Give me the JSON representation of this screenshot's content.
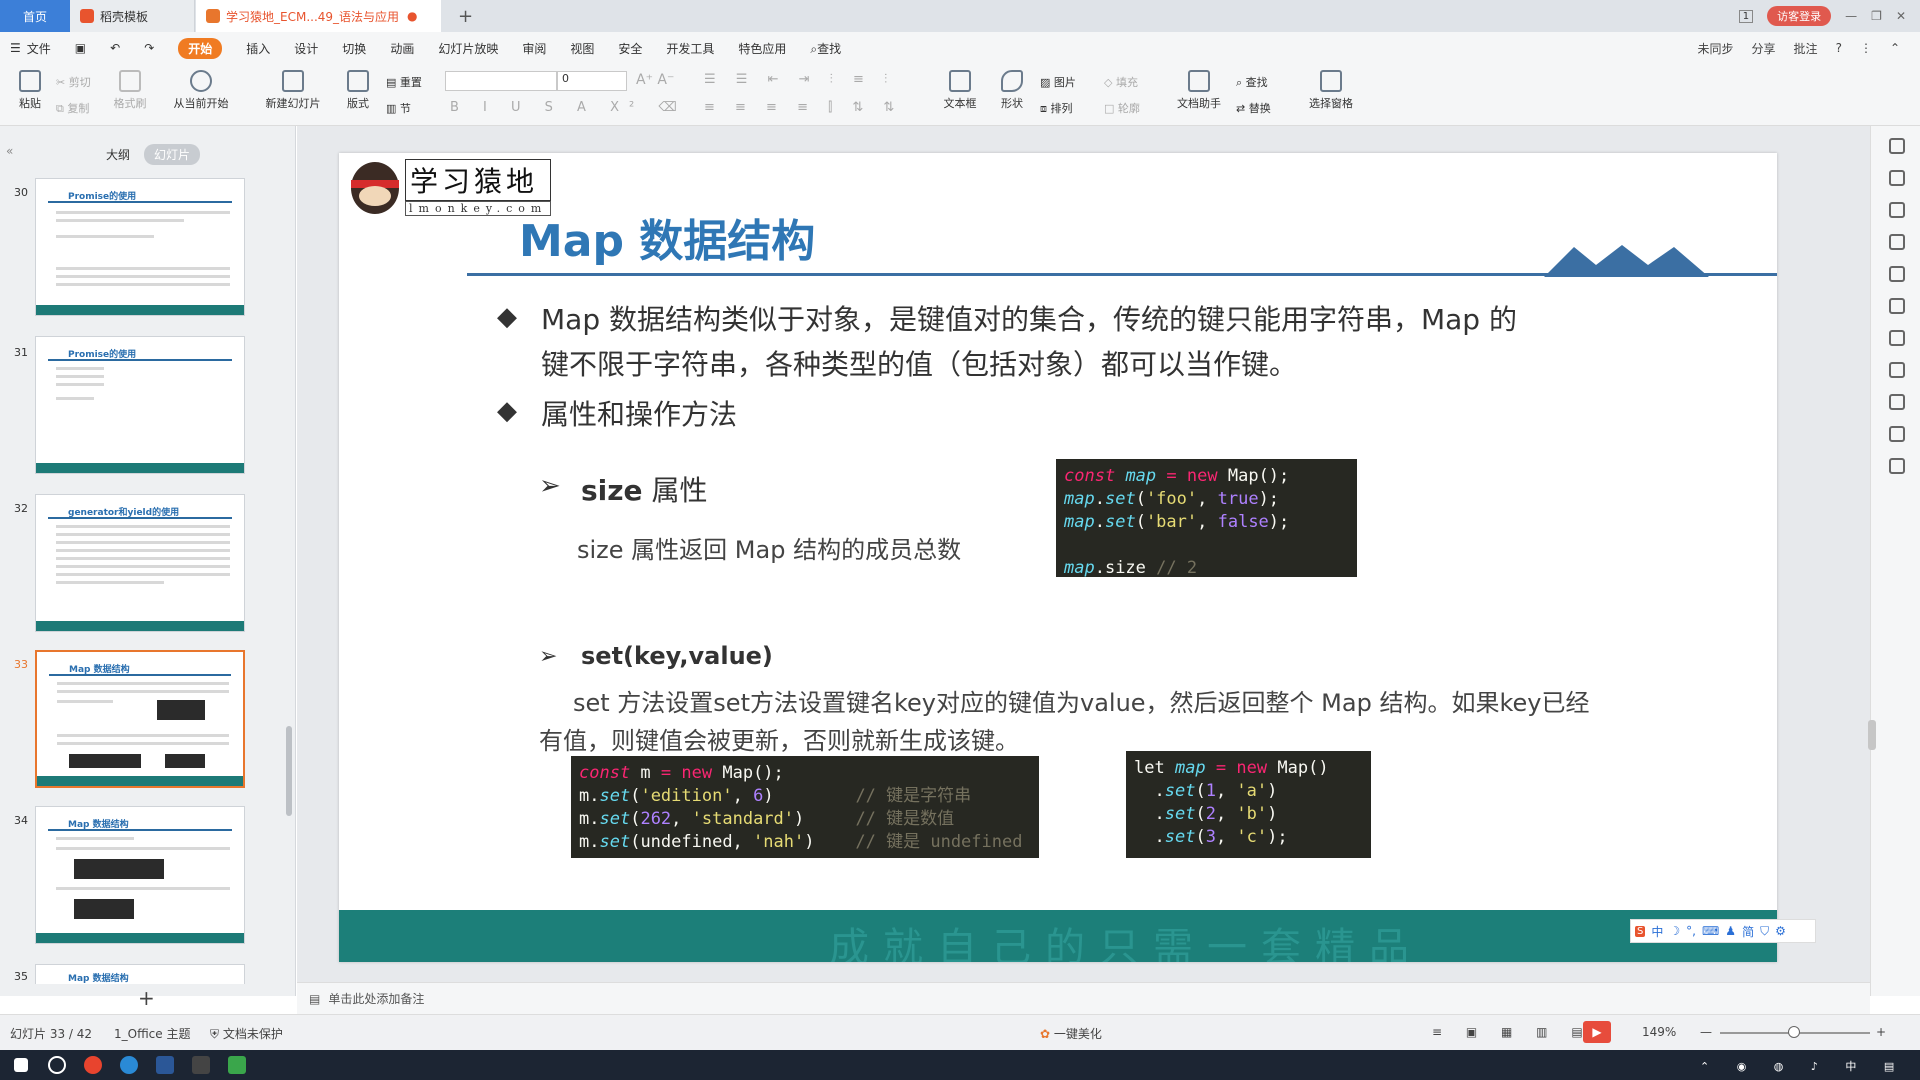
{
  "tabs": {
    "home": "首页",
    "templates": "稻壳模板",
    "document": "学习猿地_ECM...49_语法与应用",
    "new_tab": "+",
    "page_badge": "1",
    "visitor": "访客登录"
  },
  "menu": {
    "file": "文件",
    "items": [
      "开始",
      "插入",
      "设计",
      "切换",
      "动画",
      "幻灯片放映",
      "审阅",
      "视图",
      "安全",
      "开发工具",
      "特色应用",
      "查找"
    ],
    "sync": "未同步",
    "share": "分享",
    "comment": "批注"
  },
  "ribbon": {
    "paste": "粘贴",
    "cut": "剪切",
    "copy": "复制",
    "format_painter": "格式刷",
    "from_current": "从当前开始",
    "new_slide": "新建幻灯片",
    "layout": "版式",
    "reset": "重置",
    "section": "节",
    "font_size": "0",
    "textbox": "文本框",
    "shape": "形状",
    "picture": "图片",
    "fill": "填充",
    "arrange": "排列",
    "outline": "轮廓",
    "text_assistant": "文档助手",
    "find": "查找",
    "replace": "替换",
    "select_pane": "选择窗格"
  },
  "left_panel": {
    "outline_tab": "大纲",
    "slides_tab": "幻灯片",
    "thumbs": [
      {
        "num": "30",
        "title": "Promise的使用"
      },
      {
        "num": "31",
        "title": "Promise的使用"
      },
      {
        "num": "32",
        "title": "generator和yield的使用"
      },
      {
        "num": "33",
        "title": "Map 数据结构"
      },
      {
        "num": "34",
        "title": "Map 数据结构"
      },
      {
        "num": "35",
        "title": "Map 数据结构"
      }
    ],
    "add": "+"
  },
  "slide": {
    "logo_cn": "学习猿地",
    "logo_en": "lmonkey.com",
    "title": "Map 数据结构",
    "bullet1_line1": "Map 数据结构类似于对象，是键值对的集合，传统的键只能用字符串，Map 的",
    "bullet1_line2": "键不限于字符串，各种类型的值（包括对象）都可以当作键。",
    "bullet2": "属性和操作方法",
    "size_heading_bold": "size",
    "size_heading_rest": " 属性",
    "size_desc": "size 属性返回 Map 结构的成员总数",
    "set_heading": "set(key,value)",
    "set_desc_line1": "set 方法设置set方法设置键名key对应的键值为value，然后返回整个 Map 结构。如果key已经",
    "set_desc_line2": "有值，则键值会被更新，否则就新生成该键。",
    "diamond": "◆",
    "arrow": "➢",
    "footer": "成就自己的只需一套精品"
  },
  "code": {
    "box1": [
      "const map = new Map();",
      "map.set('foo', true);",
      "map.set('bar', false);",
      "",
      "map.size // 2"
    ],
    "box2": [
      "const m = new Map();",
      "m.set('edition', 6)        // 键是字符串",
      "m.set(262, 'standard')     // 键是数值",
      "m.set(undefined, 'nah')    // 键是 undefined"
    ],
    "box3": [
      "let map = new Map()",
      "  .set(1, 'a')",
      "  .set(2, 'b')",
      "  .set(3, 'c');"
    ]
  },
  "ime": {
    "logo": "S",
    "items": [
      "中",
      "简"
    ]
  },
  "notes": "单击此处添加备注",
  "status": {
    "slide_count": "幻灯片 33 / 42",
    "theme": "1_Office 主题",
    "protect": "文档未保护",
    "beautify": "一键美化",
    "zoom": "149%"
  },
  "colors": {
    "accent": "#f07b22",
    "title_blue": "#2f77b5",
    "footer_teal": "#1c7f79",
    "tab_blue": "#3c7fd8"
  }
}
